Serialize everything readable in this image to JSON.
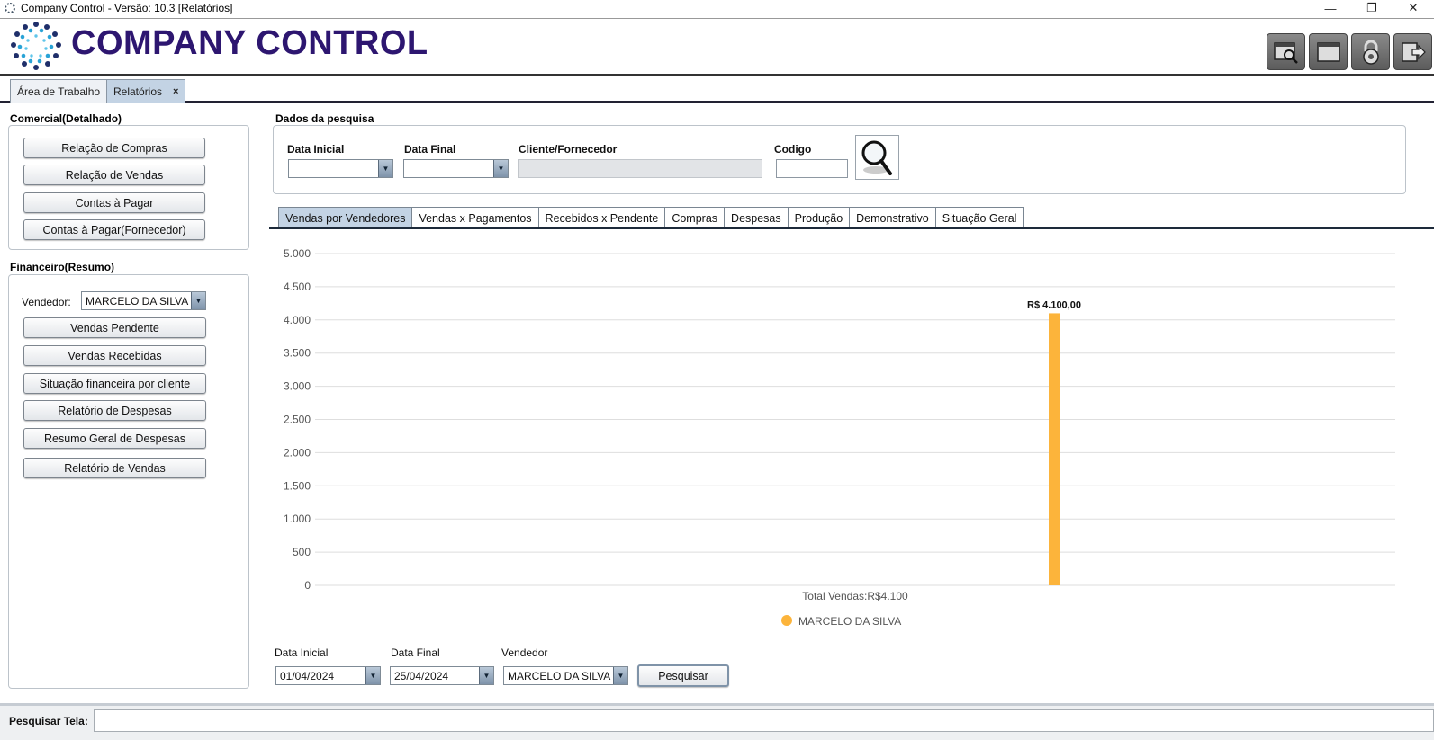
{
  "window": {
    "title": "Company Control - Versão: 10.3 [Relatórios]",
    "controls": [
      "—",
      "❐",
      "✕"
    ]
  },
  "header": {
    "brand": "COMPANY CONTROL"
  },
  "tabs": [
    {
      "label": "Área de Trabalho"
    },
    {
      "label": "Relatórios",
      "close": "×"
    }
  ],
  "left": {
    "comercial": {
      "title": "Comercial(Detalhado)",
      "buttons": [
        "Relação de Compras",
        "Relação de Vendas",
        "Contas à Pagar",
        "Contas à Pagar(Fornecedor)"
      ]
    },
    "financeiro": {
      "title": "Financeiro(Resumo)",
      "vendedor_label": "Vendedor:",
      "vendedor_value": "MARCELO DA SILVA",
      "buttons": [
        "Vendas Pendente",
        "Vendas Recebidas",
        "Situação financeira por cliente",
        "Relatório de Despesas",
        "Resumo Geral de Despesas",
        "Relatório de Vendas"
      ]
    }
  },
  "search": {
    "title": "Dados da pesquisa",
    "data_inicial_label": "Data Inicial",
    "data_final_label": "Data Final",
    "cliente_label": "Cliente/Fornecedor",
    "codigo_label": "Codigo",
    "data_inicial_value": "",
    "data_final_value": "",
    "cliente_value": "",
    "codigo_value": ""
  },
  "content_tabs": [
    "Vendas por Vendedores",
    "Vendas x Pagamentos",
    "Recebidos x  Pendente",
    "Compras",
    "Despesas",
    "Produção",
    "Demonstrativo",
    "Situação Geral"
  ],
  "chart_data": {
    "type": "bar",
    "categories": [
      "Total Vendas:R$4.100"
    ],
    "series": [
      {
        "name": "MARCELO DA SILVA",
        "values": [
          4100
        ],
        "color": "#fcb43b"
      }
    ],
    "data_labels": [
      "R$ 4.100,00"
    ],
    "y_ticks": [
      "0",
      "500",
      "1.000",
      "1.500",
      "2.000",
      "2.500",
      "3.000",
      "3.500",
      "4.000",
      "4.500",
      "5.000"
    ],
    "ylim": [
      0,
      5000
    ],
    "grid": true,
    "legend": "bottom-center"
  },
  "filters": {
    "data_inicial_label": "Data Inicial",
    "data_final_label": "Data Final",
    "vendedor_label": "Vendedor",
    "data_inicial_value": "01/04/2024",
    "data_final_value": "25/04/2024",
    "vendedor_value": "MARCELO DA SILVA",
    "pesquisar": "Pesquisar"
  },
  "footer": {
    "label": "Pesquisar Tela:",
    "value": ""
  }
}
